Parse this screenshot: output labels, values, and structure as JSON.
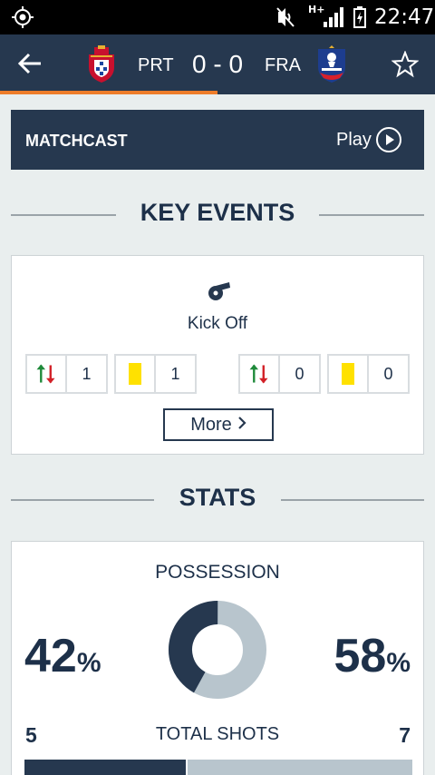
{
  "status_bar": {
    "network": "H+",
    "time": "22:47",
    "icons": [
      "location-target-icon",
      "mute-icon",
      "signal-icon",
      "battery-charging-icon"
    ]
  },
  "header": {
    "home_team": "PRT",
    "away_team": "FRA",
    "score": "0 - 0",
    "icons": [
      "back-arrow-icon",
      "portugal-crest-icon",
      "france-crest-icon",
      "star-icon"
    ],
    "accent_color": "#ee7d2a"
  },
  "matchcast": {
    "title": "MATCHCAST",
    "play_label": "Play"
  },
  "key_events": {
    "title": "KEY EVENTS",
    "event_label": "Kick Off",
    "home": {
      "substitutions": "1",
      "yellow_cards": "1"
    },
    "away": {
      "substitutions": "0",
      "yellow_cards": "0"
    },
    "more_label": "More"
  },
  "stats": {
    "title": "STATS",
    "possession": {
      "title": "POSSESSION",
      "home": "42",
      "away": "58",
      "unit": "%"
    },
    "total_shots": {
      "title": "TOTAL SHOTS",
      "home": "5",
      "away": "7"
    }
  },
  "colors": {
    "navy": "#26384f",
    "light_slate": "#b8c5cd",
    "yellow_card": "#ffe100",
    "sub_in": "#1f8a3a",
    "sub_out": "#d22027"
  }
}
